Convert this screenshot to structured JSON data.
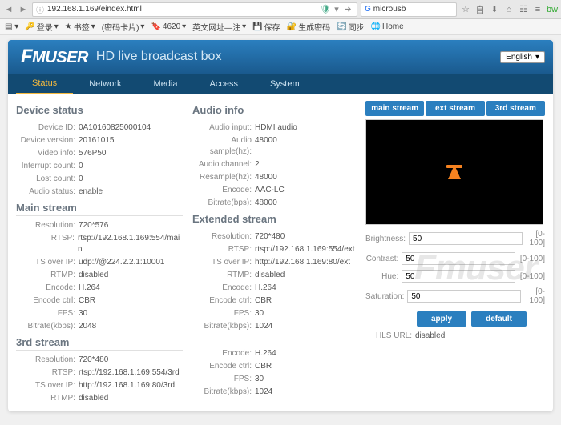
{
  "browser": {
    "url": "192.168.1.169/eindex.html",
    "search": "microusb"
  },
  "bookmarks": {
    "items": [
      "登录",
      "书签",
      "(密码卡片)",
      "4620",
      "英文网址—注",
      "保存",
      "生成密码",
      "同步",
      "Home"
    ]
  },
  "header": {
    "logo": "Fmuser",
    "tagline": "HD live broadcast box",
    "lang": "English"
  },
  "tabs": [
    "Status",
    "Network",
    "Media",
    "Access",
    "System"
  ],
  "device_status": {
    "title": "Device status",
    "rows": [
      {
        "lbl": "Device ID:",
        "val": "0A10160825000104"
      },
      {
        "lbl": "Device version:",
        "val": "20161015"
      },
      {
        "lbl": "Video info:",
        "val": "576P50"
      },
      {
        "lbl": "Interrupt count:",
        "val": "0"
      },
      {
        "lbl": "Lost count:",
        "val": "0"
      },
      {
        "lbl": "Audio status:",
        "val": "enable"
      }
    ]
  },
  "audio_info": {
    "title": "Audio info",
    "rows": [
      {
        "lbl": "Audio input:",
        "val": "HDMI audio"
      },
      {
        "lbl": "Audio sample(hz):",
        "val": "48000"
      },
      {
        "lbl": "Audio channel:",
        "val": "2"
      },
      {
        "lbl": "Resample(hz):",
        "val": "48000"
      },
      {
        "lbl": "Encode:",
        "val": "AAC-LC"
      },
      {
        "lbl": "Bitrate(bps):",
        "val": "48000"
      }
    ]
  },
  "main_stream": {
    "title": "Main stream",
    "rows": [
      {
        "lbl": "Resolution:",
        "val": "720*576"
      },
      {
        "lbl": "RTSP:",
        "val": "rtsp://192.168.1.169:554/main"
      },
      {
        "lbl": "TS over IP:",
        "val": "udp://@224.2.2.1:10001"
      },
      {
        "lbl": "RTMP:",
        "val": "disabled"
      },
      {
        "lbl": "Encode:",
        "val": "H.264"
      },
      {
        "lbl": "Encode ctrl:",
        "val": "CBR"
      },
      {
        "lbl": "FPS:",
        "val": "30"
      },
      {
        "lbl": "Bitrate(kbps):",
        "val": "2048"
      }
    ]
  },
  "ext_stream": {
    "title": "Extended stream",
    "rows": [
      {
        "lbl": "Resolution:",
        "val": "720*480"
      },
      {
        "lbl": "RTSP:",
        "val": "rtsp://192.168.1.169:554/ext"
      },
      {
        "lbl": "TS over IP:",
        "val": "http://192.168.1.169:80/ext"
      },
      {
        "lbl": "RTMP:",
        "val": "disabled"
      },
      {
        "lbl": "Encode:",
        "val": "H.264"
      },
      {
        "lbl": "Encode ctrl:",
        "val": "CBR"
      },
      {
        "lbl": "FPS:",
        "val": "30"
      },
      {
        "lbl": "Bitrate(kbps):",
        "val": "1024"
      }
    ]
  },
  "third_stream_left": {
    "title": "3rd stream",
    "rows": [
      {
        "lbl": "Resolution:",
        "val": "720*480"
      },
      {
        "lbl": "RTSP:",
        "val": "rtsp://192.168.1.169:554/3rd"
      },
      {
        "lbl": "TS over IP:",
        "val": "http://192.168.1.169:80/3rd"
      },
      {
        "lbl": "RTMP:",
        "val": "disabled"
      }
    ]
  },
  "third_stream_right": {
    "rows": [
      {
        "lbl": "Encode:",
        "val": "H.264"
      },
      {
        "lbl": "Encode ctrl:",
        "val": "CBR"
      },
      {
        "lbl": "FPS:",
        "val": "30"
      },
      {
        "lbl": "Bitrate(kbps):",
        "val": "1024"
      }
    ]
  },
  "stream_tabs": [
    "main stream",
    "ext stream",
    "3rd stream"
  ],
  "controls": {
    "brightness": {
      "lbl": "Brightness:",
      "val": "50",
      "range": "[0-100]"
    },
    "contrast": {
      "lbl": "Contrast:",
      "val": "50",
      "range": "[0-100]"
    },
    "hue": {
      "lbl": "Hue:",
      "val": "50",
      "range": "[0-100]"
    },
    "saturation": {
      "lbl": "Saturation:",
      "val": "50",
      "range": "[0-100]"
    }
  },
  "buttons": {
    "apply": "apply",
    "default": "default"
  },
  "hls": {
    "lbl": "HLS URL:",
    "val": "disabled"
  },
  "watermark": "Fmuser"
}
